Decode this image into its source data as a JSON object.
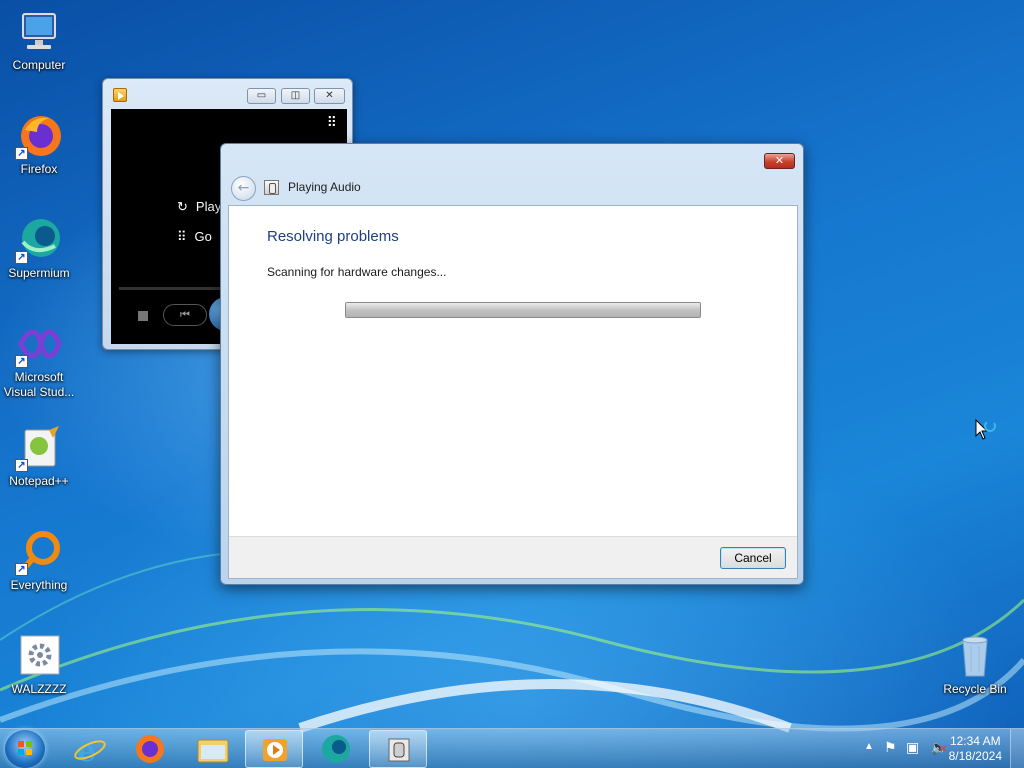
{
  "desktop": {
    "icons": [
      {
        "label": "Computer",
        "icon": "computer-icon"
      },
      {
        "label": "Firefox",
        "icon": "firefox-icon"
      },
      {
        "label": "Supermium",
        "icon": "supermium-icon"
      },
      {
        "label": "Microsoft Visual Stud...",
        "icon": "visual-studio-icon"
      },
      {
        "label": "Notepad++",
        "icon": "notepad-plus-plus-icon"
      },
      {
        "label": "Everything",
        "icon": "everything-icon"
      },
      {
        "label": "WALZZZZ",
        "icon": "settings-file-icon"
      },
      {
        "label": "Recycle Bin",
        "icon": "recycle-bin-icon"
      }
    ]
  },
  "media_player": {
    "menu_items": [
      "Play",
      "Go"
    ],
    "icon": "windows-media-player-icon"
  },
  "dialog": {
    "title": "Playing Audio",
    "heading": "Resolving problems",
    "status": "Scanning for hardware changes...",
    "progress": 1.0,
    "cancel_label": "Cancel"
  },
  "taskbar": {
    "apps": [
      "internet-explorer-icon",
      "firefox-icon",
      "file-explorer-icon",
      "windows-media-player-icon",
      "supermium-icon",
      "troubleshooter-icon"
    ],
    "time": "12:34 AM",
    "date": "8/18/2024"
  },
  "colors": {
    "heading": "#1d3f86",
    "accent_blue": "#1677cf",
    "close_red": "#c7432d"
  }
}
